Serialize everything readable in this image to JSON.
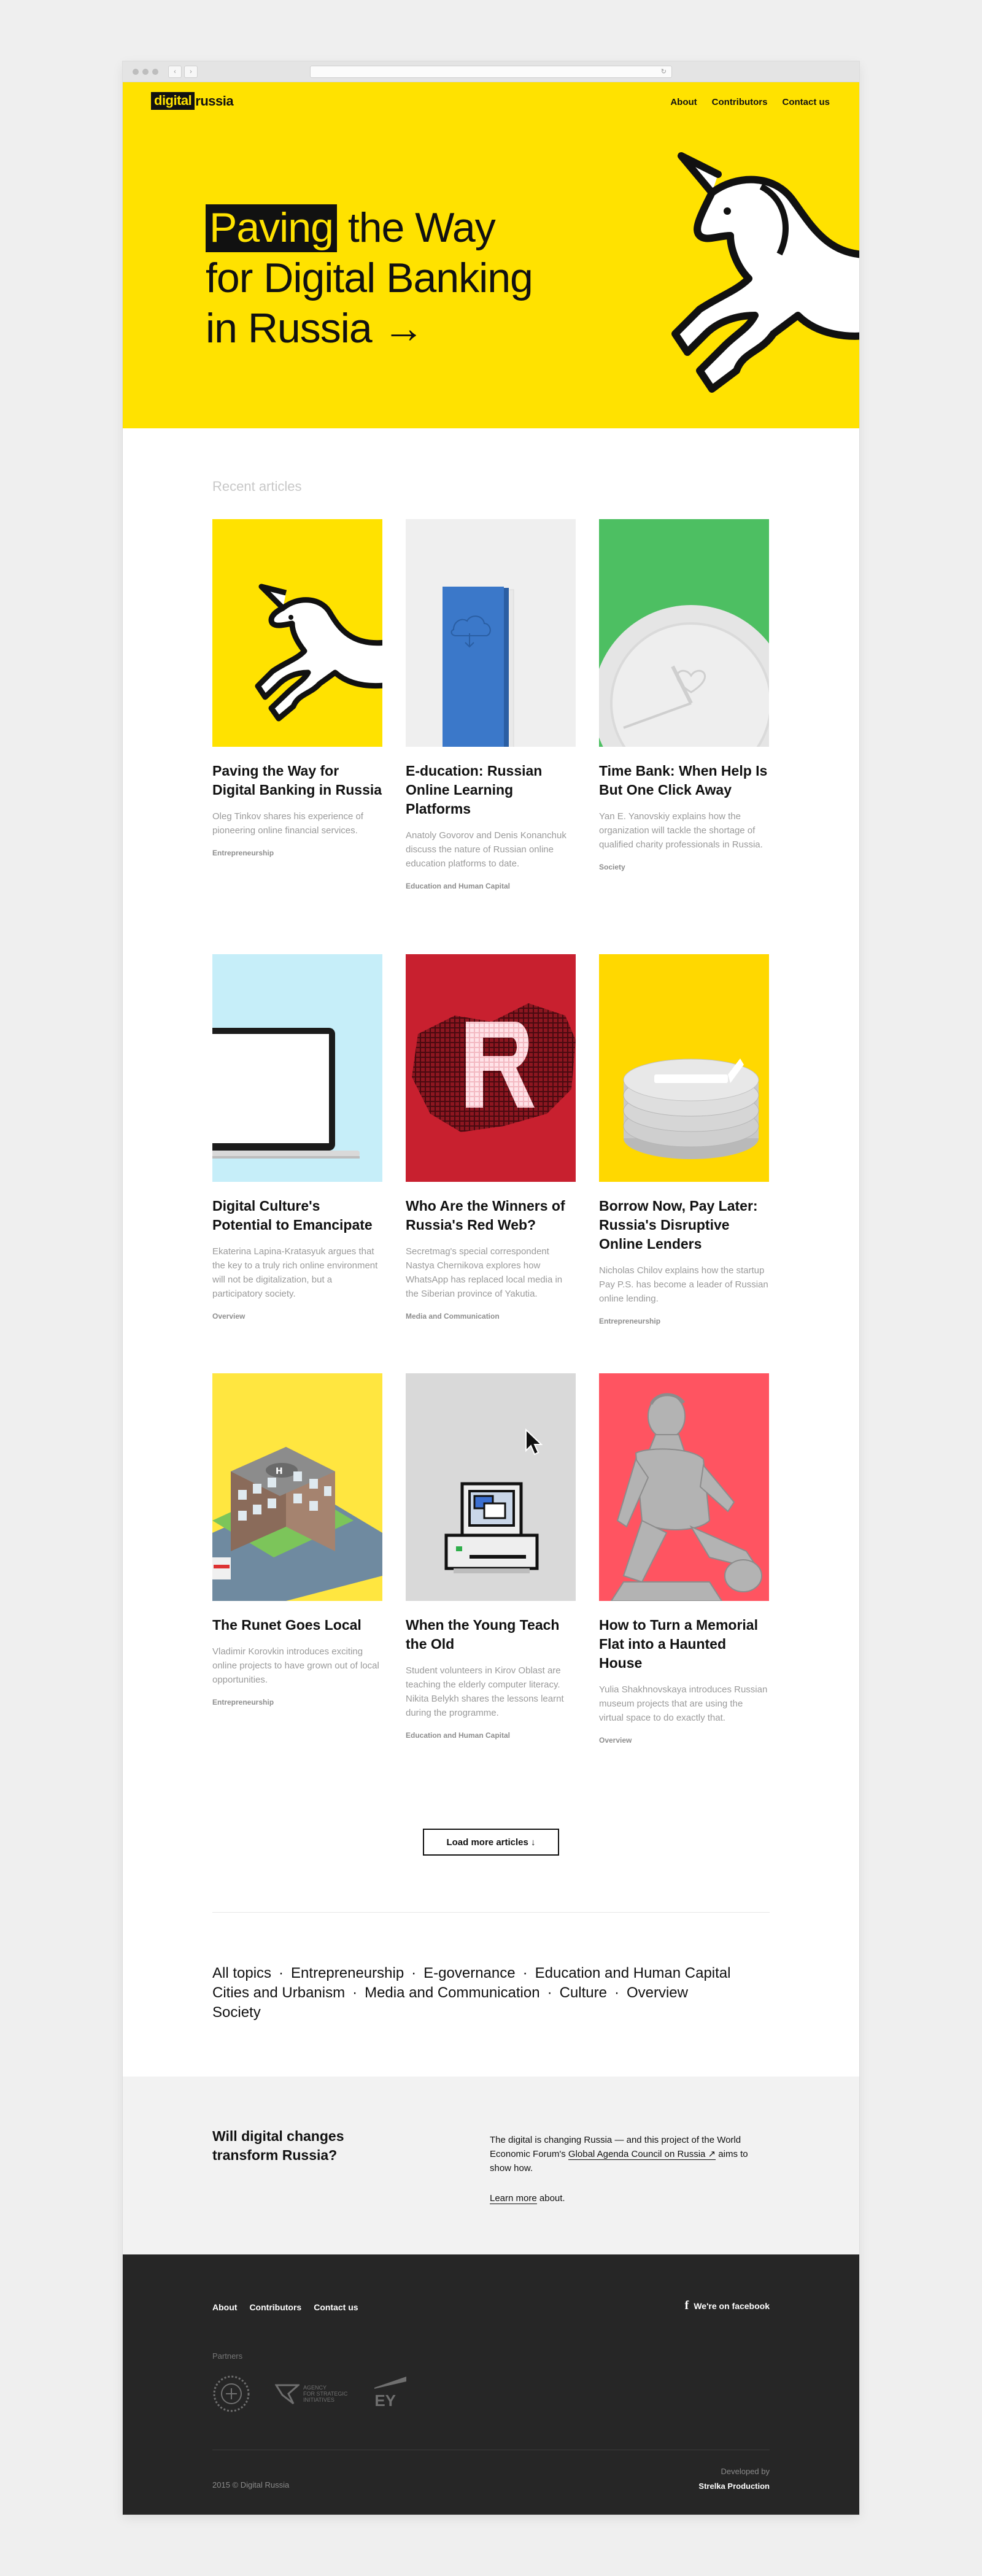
{
  "header": {
    "logo_box": "digital",
    "logo_rest": "russia",
    "nav": [
      "About",
      "Contributors",
      "Contact us"
    ]
  },
  "hero": {
    "title_highlight": "Paving",
    "title_line1_rest": " the Way",
    "title_line2": "for Digital Banking",
    "title_line3": "in Russia →"
  },
  "main": {
    "section_label": "Recent articles",
    "articles": [
      {
        "title": "Paving the Way for Digital Banking in Russia",
        "desc": "Oleg Tinkov shares his experience of pioneering online financial services.",
        "tag": "Entrepreneurship",
        "image": "unicorn-icon",
        "bg": "#ffe200"
      },
      {
        "title": "E-ducation: Russian Online Learning Platforms",
        "desc": "Anatoly Govorov and Denis Konanchuk discuss the nature of Russian online education platforms to date.",
        "tag": "Education and Human Capital",
        "image": "book-icon",
        "bg": "#efefef"
      },
      {
        "title": "Time Bank: When Help Is But One Click Away",
        "desc": "Yan E. Yanovskiy explains how the organization will tackle the shortage of qualified charity professionals in Russia.",
        "tag": "Society",
        "image": "clock-icon",
        "bg": "#4dbf62"
      },
      {
        "title": "Digital Culture's Potential to Emancipate",
        "desc": "Ekaterina Lapina-Kratasyuk argues that the key to a truly rich online environment will not be digitalization, but a participatory society.",
        "tag": "Overview",
        "image": "laptop-icon",
        "bg": "#c6eef9"
      },
      {
        "title": "Who Are the Winners of Russia's Red Web?",
        "desc": "Secretmag's special correspondent Nastya Chernikova explores how WhatsApp has replaced local media in the Siberian province of Yakutia.",
        "tag": "Media and Communication",
        "image": "pixel-r-icon",
        "bg": "#c8202f"
      },
      {
        "title": "Borrow Now, Pay Later: Russia's Disruptive Online Lenders",
        "desc": "Nicholas Chilov explains how the startup Pay P.S. has become a leader of Russian online lending.",
        "tag": "Entrepreneurship",
        "image": "coins-icon",
        "bg": "#ffd800"
      },
      {
        "title": "The Runet Goes Local",
        "desc": "Vladimir Korovkin introduces exciting online projects to have grown out of local opportunities.",
        "tag": "Entrepreneurship",
        "image": "hospital-icon",
        "bg": "#ffe640"
      },
      {
        "title": "When the Young Teach the Old",
        "desc": "Student volunteers in Kirov Oblast are teaching the elderly computer literacy. Nikita Belykh shares the lessons learnt during the programme.",
        "tag": "Education and Human Capital",
        "image": "retro-computer-icon",
        "bg": "#d9d9d9"
      },
      {
        "title": "How to Turn a Memorial Flat into a Haunted House",
        "desc": "Yulia Shakhnovskaya introduces Russian museum projects that are using the virtual space to do exactly that.",
        "tag": "Overview",
        "image": "statue-icon",
        "bg": "#ff5461"
      }
    ],
    "load_more": "Load more articles ↓"
  },
  "topics": [
    "All topics",
    "Entrepreneurship",
    "E-governance",
    "Education and Human Capital",
    "Cities and Urbanism",
    "Media and Communication",
    "Culture",
    "Overview",
    "Society"
  ],
  "about": {
    "question": "Will digital changes transform Russia?",
    "text_before": "The digital is changing Russia — and this project of the World Economic Forum's ",
    "text_link": "Global Agenda Council on Russia ↗",
    "text_after": " aims to show how.",
    "learn_more_link": "Learn more",
    "learn_more_rest": " about."
  },
  "footer": {
    "nav": [
      "About",
      "Contributors",
      "Contact us"
    ],
    "facebook": "We're on facebook",
    "partners_label": "Partners",
    "partner_asi_1": "AGENCY",
    "partner_asi_2": "FOR STRATEGIC",
    "partner_asi_3": "INITIATIVES",
    "partner_ey": "EY",
    "copyright": "2015 © Digital Russia",
    "developed_by": "Developed by",
    "developer": "Strelka Production"
  },
  "colors": {
    "brand_yellow": "#ffe200",
    "dark": "#111111",
    "footer_bg": "#262626"
  }
}
